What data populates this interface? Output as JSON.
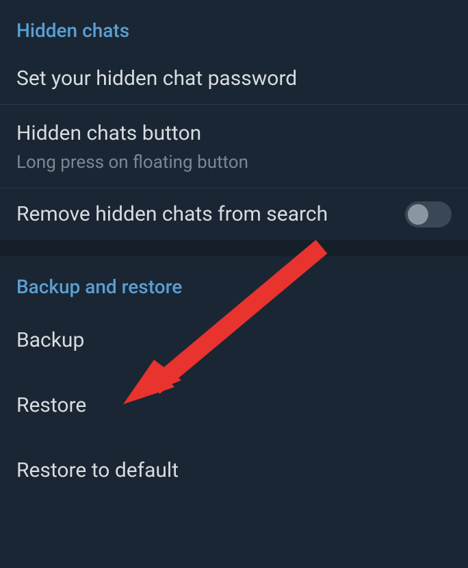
{
  "sections": {
    "hidden_chats": {
      "header": "Hidden chats",
      "items": {
        "set_password": {
          "title": "Set your hidden chat password"
        },
        "hidden_button": {
          "title": "Hidden chats button",
          "subtitle": "Long press on floating button"
        },
        "remove_search": {
          "title": "Remove hidden chats from search",
          "toggle_state": "off"
        }
      }
    },
    "backup_restore": {
      "header": "Backup and restore",
      "items": {
        "backup": {
          "title": "Backup"
        },
        "restore": {
          "title": "Restore"
        },
        "restore_default": {
          "title": "Restore to default"
        }
      }
    }
  },
  "annotation": {
    "arrow_color": "#e8332f"
  }
}
